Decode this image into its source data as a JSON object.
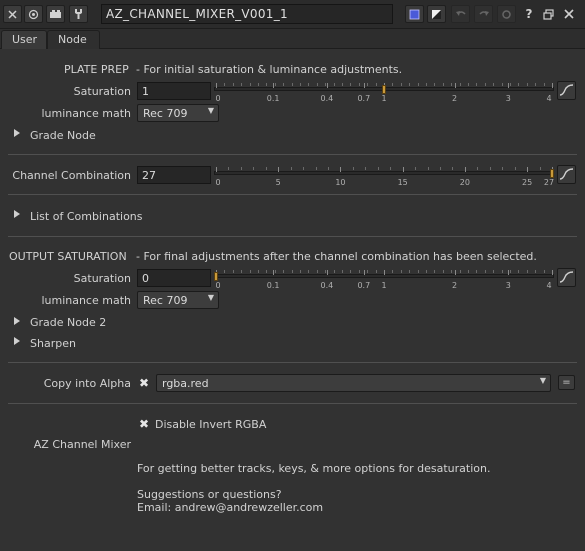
{
  "titlebar": {
    "node_name": "AZ_CHANNEL_MIXER_V001_1"
  },
  "tabs": [
    {
      "label": "User",
      "active": true
    },
    {
      "label": "Node",
      "active": false
    }
  ],
  "plate_prep": {
    "header": "PLATE PREP",
    "description": "- For initial saturation & luminance adjustments.",
    "saturation_label": "Saturation",
    "saturation_value": "1",
    "saturation_ticks": [
      "0",
      "0.1",
      "0.4",
      "0.7",
      "1",
      "2",
      "3",
      "4"
    ],
    "saturation_handle_value": 1,
    "luminance_label": "luminance math",
    "luminance_value": "Rec 709",
    "grade_node_label": "Grade Node"
  },
  "channel_combination": {
    "label": "Channel Combination",
    "value": "27",
    "ticks": [
      "0",
      "5",
      "10",
      "15",
      "20",
      "25",
      "27"
    ],
    "handle_value": 27,
    "list_label": "List of Combinations"
  },
  "output_saturation": {
    "header": "OUTPUT SATURATION",
    "description": "- For final adjustments after the channel combination has been selected.",
    "saturation_label": "Saturation",
    "saturation_value": "0",
    "saturation_ticks": [
      "0",
      "0.1",
      "0.4",
      "0.7",
      "1",
      "2",
      "3",
      "4"
    ],
    "saturation_handle_value": 0,
    "luminance_label": "luminance math",
    "luminance_value": "Rec 709",
    "grade_node_2_label": "Grade Node 2",
    "sharpen_label": "Sharpen"
  },
  "copy_alpha": {
    "label": "Copy into Alpha",
    "checked": true,
    "channel_value": "rgba.red",
    "eq_label": "="
  },
  "footer": {
    "disable_invert_label": "Disable Invert RGBA",
    "disable_invert_checked": true,
    "section_label": "AZ Channel Mixer",
    "info_line": "For getting better tracks, keys, & more options for desaturation.",
    "suggestions_line": "Suggestions or questions?",
    "email_line": "Email: andrew@andrewzeller.com"
  },
  "colors": {
    "background": "#323232",
    "slider_handle": "#c99a3a",
    "viewer_button_blue": "#4a5ad8"
  }
}
